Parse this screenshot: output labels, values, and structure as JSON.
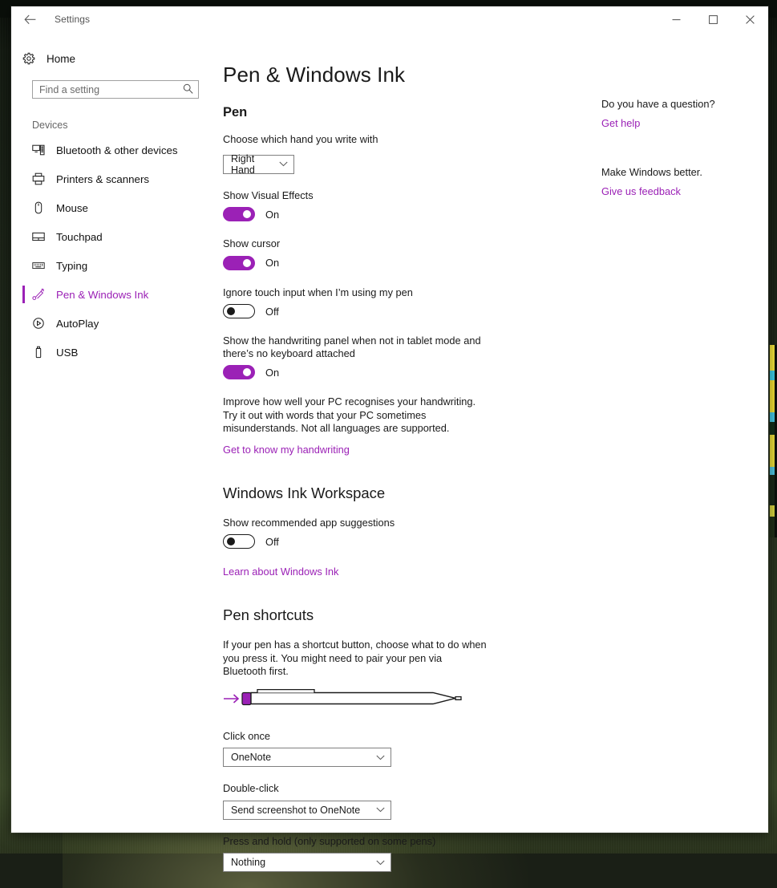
{
  "window": {
    "titlebar_title": "Settings",
    "back_icon": "back-arrow-icon",
    "minimize_label": "Minimize",
    "maximize_label": "Maximize",
    "close_label": "Close"
  },
  "accent_color": "#9B21B6",
  "sidebar": {
    "home": {
      "label": "Home",
      "icon": "gear-icon"
    },
    "search": {
      "placeholder": "Find a setting",
      "value": "",
      "icon": "search-icon"
    },
    "category": "Devices",
    "items": [
      {
        "label": "Bluetooth & other devices",
        "icon": "bluetooth-devices-icon",
        "selected": false
      },
      {
        "label": "Printers & scanners",
        "icon": "printer-icon",
        "selected": false
      },
      {
        "label": "Mouse",
        "icon": "mouse-icon",
        "selected": false
      },
      {
        "label": "Touchpad",
        "icon": "touchpad-icon",
        "selected": false
      },
      {
        "label": "Typing",
        "icon": "keyboard-icon",
        "selected": false
      },
      {
        "label": "Pen & Windows Ink",
        "icon": "pen-icon",
        "selected": true
      },
      {
        "label": "AutoPlay",
        "icon": "play-circle-icon",
        "selected": false
      },
      {
        "label": "USB",
        "icon": "usb-icon",
        "selected": false
      }
    ]
  },
  "main": {
    "page_title": "Pen & Windows Ink",
    "pen_section": {
      "title": "Pen",
      "hand_label": "Choose which hand you write with",
      "hand_value": "Right Hand",
      "toggles": [
        {
          "label": "Show Visual Effects",
          "state": "On",
          "on": true
        },
        {
          "label": "Show cursor",
          "state": "On",
          "on": true
        },
        {
          "label": "Ignore touch input when I’m using my pen",
          "state": "Off",
          "on": false
        },
        {
          "label": "Show the handwriting panel when not in tablet mode and there’s no keyboard attached",
          "state": "On",
          "on": true
        }
      ],
      "handwriting_text": "Improve how well your PC recognises your handwriting. Try it out with words that your PC sometimes misunderstands. Not all languages are supported.",
      "handwriting_link": "Get to know my handwriting"
    },
    "ink_workspace": {
      "title": "Windows Ink Workspace",
      "toggle_label": "Show recommended app suggestions",
      "toggle_state": "Off",
      "toggle_on": false,
      "link": "Learn about Windows Ink"
    },
    "pen_shortcuts": {
      "title": "Pen shortcuts",
      "description": "If your pen has a shortcut button, choose what to do when you press it. You might need to pair your pen via Bluetooth first.",
      "illustration": "surface-pen-illustration",
      "fields": [
        {
          "label": "Click once",
          "value": "OneNote"
        },
        {
          "label": "Double-click",
          "value": "Send screenshot to OneNote"
        },
        {
          "label": "Press and hold (only supported on some pens)",
          "value": "Nothing"
        }
      ]
    }
  },
  "help_panel": {
    "groups": [
      {
        "heading": "Do you have a question?",
        "link": "Get help"
      },
      {
        "heading": "Make Windows better.",
        "link": "Give us feedback"
      }
    ]
  }
}
